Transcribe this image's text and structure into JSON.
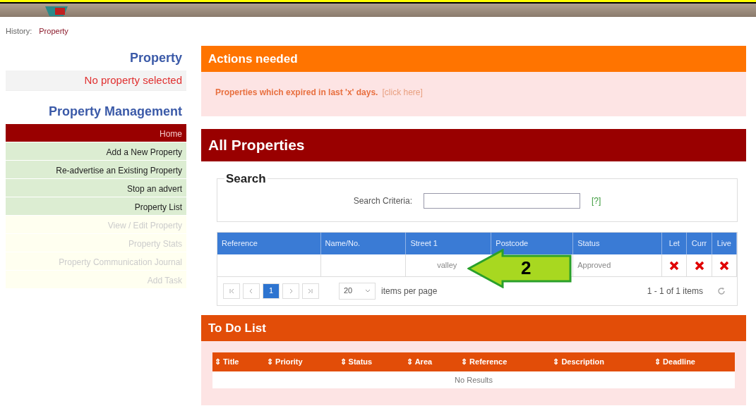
{
  "history": {
    "label": "History:",
    "link": "Property"
  },
  "sidebar": {
    "property_title": "Property",
    "property_status": "No property selected",
    "management_title": "Property Management",
    "items": [
      {
        "label": "Home",
        "selected": true,
        "disabled": false
      },
      {
        "label": "Add a New Property",
        "selected": false,
        "disabled": false
      },
      {
        "label": "Re-advertise an Existing Property",
        "selected": false,
        "disabled": false
      },
      {
        "label": "Stop an advert",
        "selected": false,
        "disabled": false
      },
      {
        "label": "Property List",
        "selected": false,
        "disabled": false
      },
      {
        "label": "View / Edit Property",
        "selected": false,
        "disabled": true
      },
      {
        "label": "Property Stats",
        "selected": false,
        "disabled": true
      },
      {
        "label": "Property Communication Journal",
        "selected": false,
        "disabled": true
      },
      {
        "label": "Add Task",
        "selected": false,
        "disabled": true
      }
    ]
  },
  "actions": {
    "title": "Actions needed",
    "message": "Properties which expired in last 'x' days.",
    "link": "[click here]"
  },
  "all_properties": {
    "title": "All Properties",
    "search": {
      "legend": "Search",
      "label": "Search Criteria:",
      "help": "[?]"
    },
    "table": {
      "columns": [
        "Reference",
        "Name/No.",
        "Street 1",
        "Postcode",
        "Status",
        "Let",
        "Curr",
        "Live"
      ],
      "rows": [
        {
          "reference": "",
          "name": "",
          "street": "valley",
          "postcode": "",
          "status": "Approved",
          "let": false,
          "curr": false,
          "live": false
        }
      ]
    },
    "pager": {
      "pages": [
        {
          "label": "1",
          "selected": true
        }
      ],
      "page_size": "20",
      "page_size_label": "items per page",
      "summary": "1 - 1 of 1 items"
    }
  },
  "callout": {
    "label": "2"
  },
  "todo": {
    "title": "To Do List",
    "columns": [
      "Title",
      "Priority",
      "Status",
      "Area",
      "Reference",
      "Description",
      "Deadline"
    ],
    "sort_glyph": "⇕",
    "empty": "No Results"
  }
}
